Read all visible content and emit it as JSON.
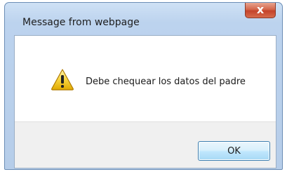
{
  "dialog": {
    "title": "Message from webpage",
    "close_label": "x",
    "message": "Debe chequear los datos del padre",
    "icon": "warning-icon",
    "ok_label": "OK"
  }
}
